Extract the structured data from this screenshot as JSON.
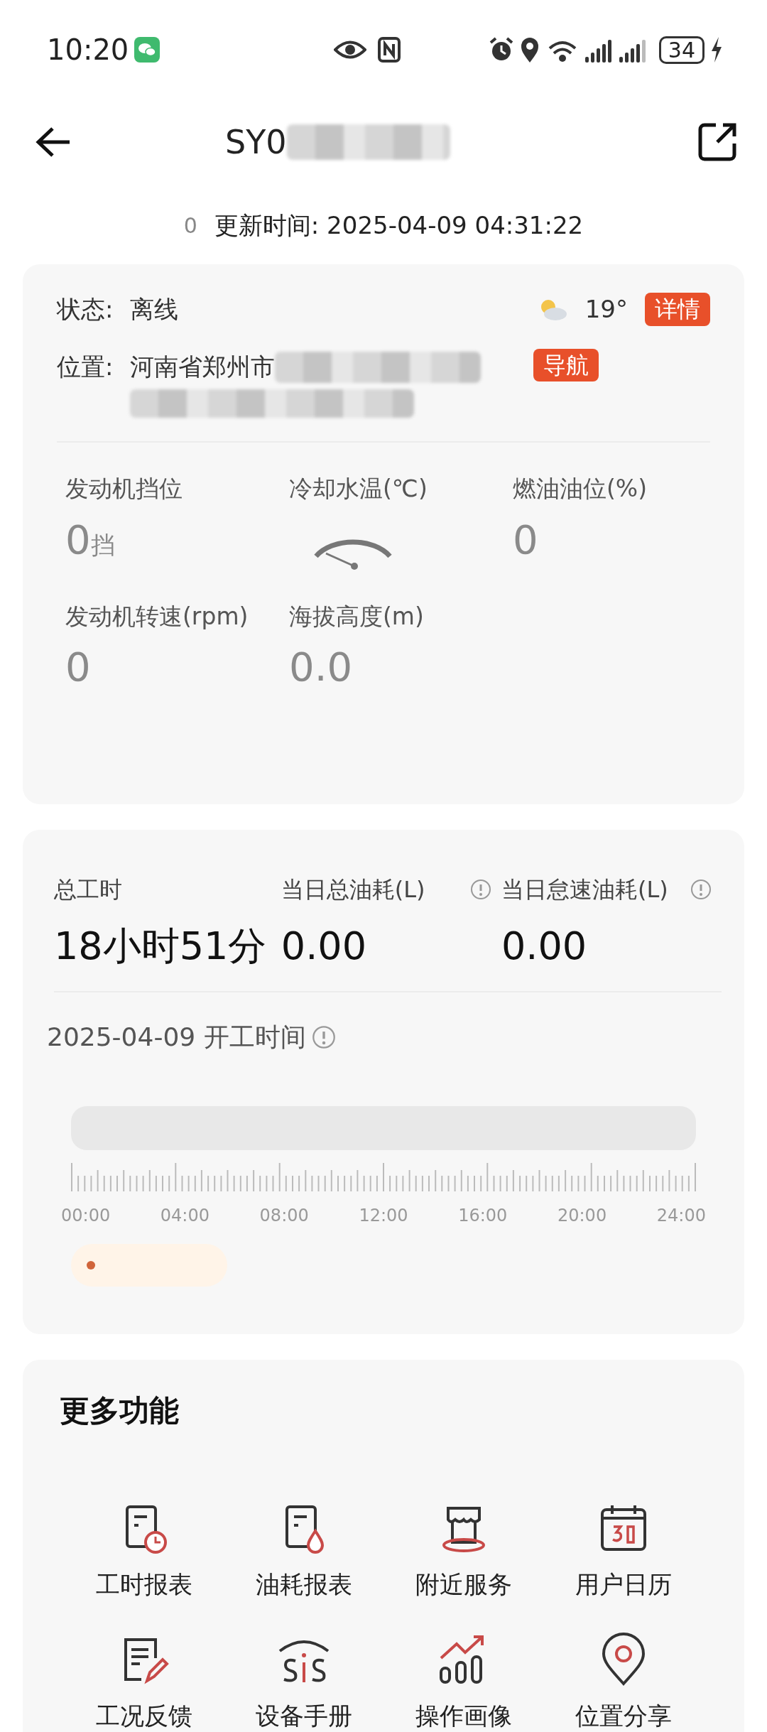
{
  "status_bar": {
    "time": "10:20",
    "battery": "34"
  },
  "header": {
    "title": "SY0"
  },
  "update": {
    "count": "0",
    "label": "更新时间: 2025-04-09 04:31:22"
  },
  "status_card": {
    "status_label": "状态:",
    "status_value": "离线",
    "temperature": "19°",
    "detail_button": "详情",
    "location_label": "位置:",
    "location_value": "河南省郑州市",
    "nav_button": "导航",
    "metrics": [
      {
        "label": "发动机挡位",
        "value": "0",
        "unit": "挡",
        "kind": "value"
      },
      {
        "label": "冷却水温(℃)",
        "kind": "gauge"
      },
      {
        "label": "燃油油位(%)",
        "value": "0",
        "kind": "value"
      },
      {
        "label": "发动机转速(rpm)",
        "value": "0",
        "kind": "value"
      },
      {
        "label": "海拔高度(m)",
        "value": "0.0",
        "kind": "value"
      }
    ]
  },
  "work_card": {
    "stats": [
      {
        "label": "总工时",
        "value": "18小时51分",
        "info": false
      },
      {
        "label": "当日总油耗(L)",
        "value": "0.00",
        "info": true
      },
      {
        "label": "当日怠速油耗(L)",
        "value": "0.00",
        "info": true
      }
    ],
    "timeline_title": "2025-04-09 开工时间",
    "time_labels": [
      "00:00",
      "04:00",
      "08:00",
      "12:00",
      "16:00",
      "20:00",
      "24:00"
    ]
  },
  "more": {
    "title": "更多功能",
    "items": [
      {
        "label": "工时报表"
      },
      {
        "label": "油耗报表"
      },
      {
        "label": "附近服务"
      },
      {
        "label": "用户日历"
      },
      {
        "label": "工况反馈"
      },
      {
        "label": "设备手册"
      },
      {
        "label": "操作画像"
      },
      {
        "label": "位置分享"
      }
    ]
  }
}
